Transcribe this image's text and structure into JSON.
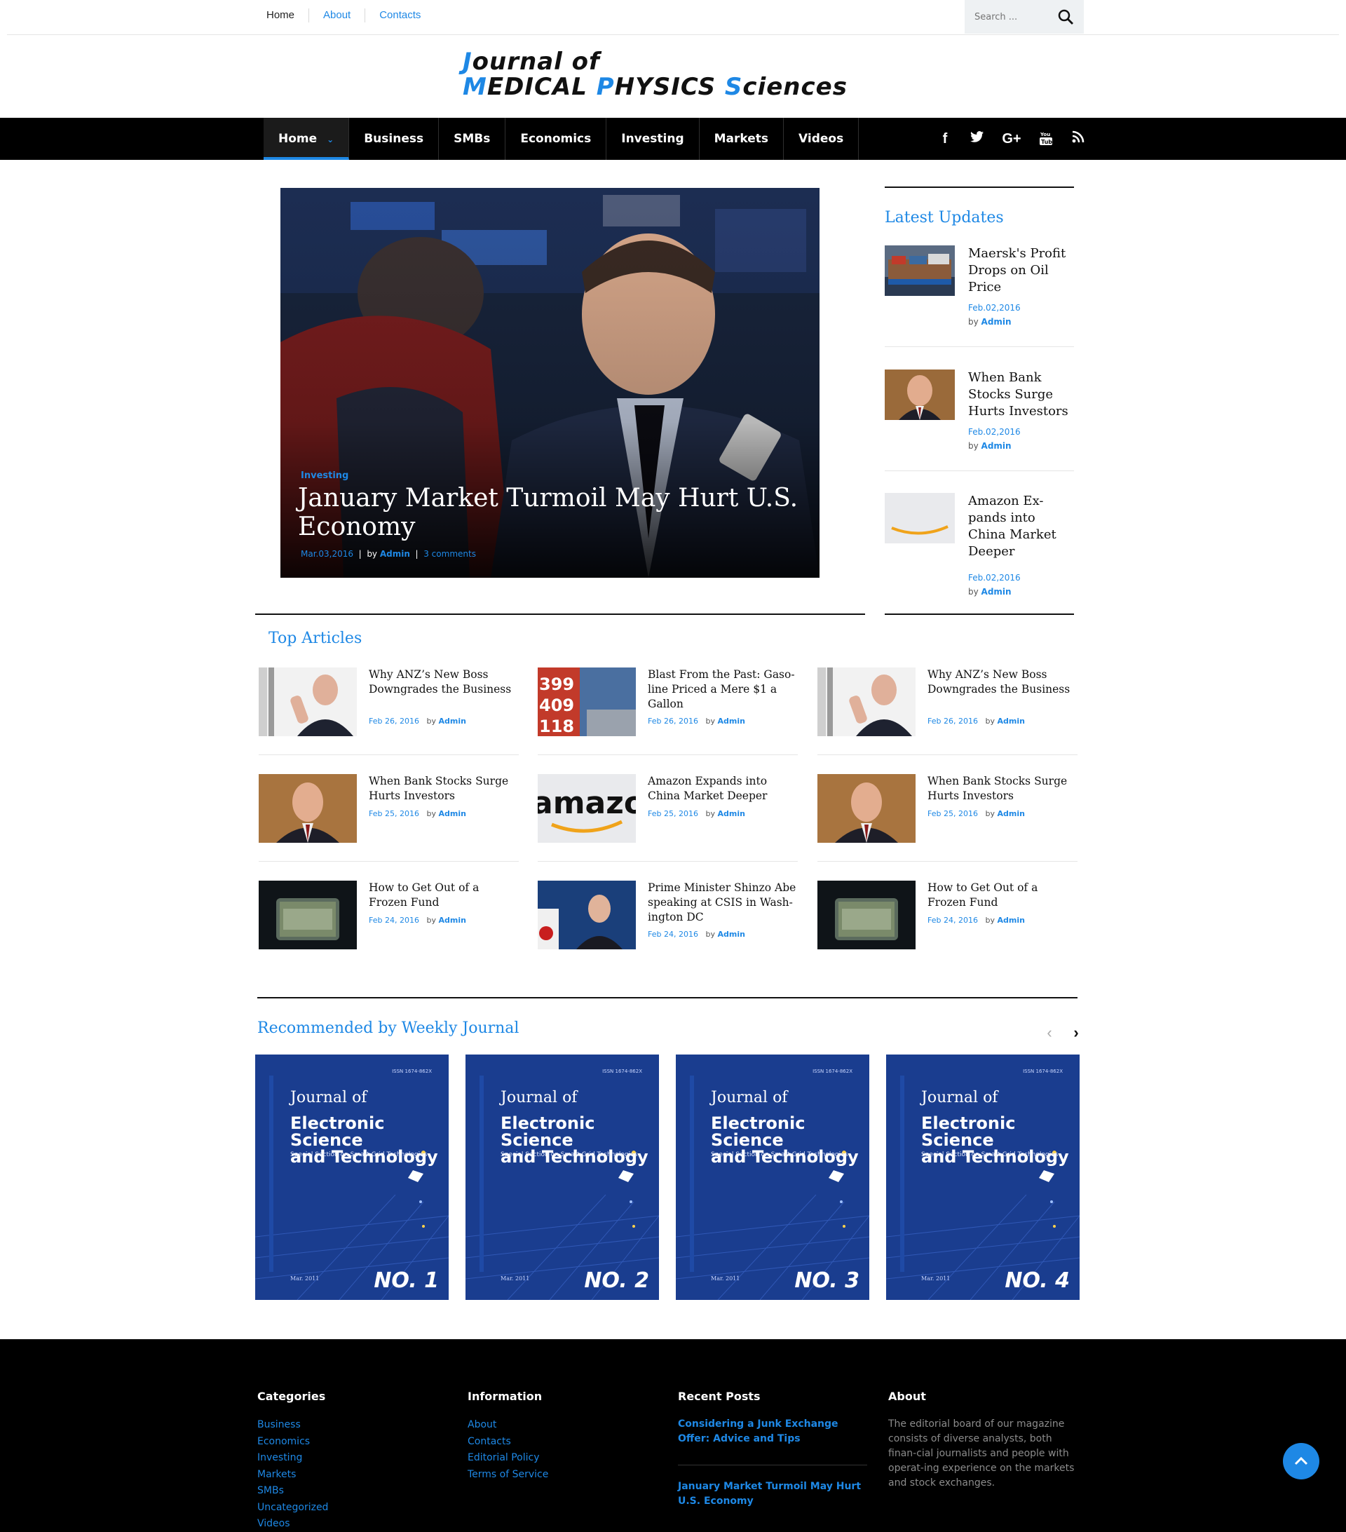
{
  "topbar": {
    "links": [
      "Home",
      "About",
      "Contacts"
    ],
    "search_placeholder": "Search ..."
  },
  "logo": {
    "line1_a": "J",
    "line1_b": "ournal of",
    "line2_a": "M",
    "line2_b": "EDICAL ",
    "line2_c": "P",
    "line2_d": "HYSICS ",
    "line2_e": "S",
    "line2_f": "ciences"
  },
  "nav": {
    "items": [
      "Home",
      "Business",
      "SMBs",
      "Economics",
      "Investing",
      "Markets",
      "Videos"
    ],
    "social": [
      "facebook-icon",
      "twitter-icon",
      "google-plus-icon",
      "youtube-icon",
      "rss-icon"
    ]
  },
  "hero": {
    "category": "Investing",
    "title": "January Market Turmoil May Hurt U.S. Economy",
    "date": "Mar.03,2016",
    "by": "by",
    "author": "Admin",
    "comments": "3 comments",
    "sep": "|"
  },
  "latest": {
    "heading": "Latest Updates",
    "items": [
      {
        "title": "Maersk's Profit Drops on Oil Price",
        "date": "Feb.02,2016",
        "by": "by",
        "author": "Admin"
      },
      {
        "title": "When Bank Stocks Surge Hurts Investors",
        "date": "Feb.02,2016",
        "by": "by",
        "author": "Admin"
      },
      {
        "title": "Amazon Ex-pands into China Market Deeper",
        "date": "Feb.02,2016",
        "by": "by",
        "author": "Admin"
      }
    ]
  },
  "top_articles": {
    "heading": "Top Articles",
    "items": [
      {
        "title": "Why ANZ’s New Boss Downgrades the Business",
        "date": "Feb 26, 2016",
        "by": "by",
        "author": "Admin"
      },
      {
        "title": "Blast From the Past: Gaso-line Priced a Mere $1 a Gallon",
        "date": "Feb 26, 2016",
        "by": "by",
        "author": "Admin"
      },
      {
        "title": "Why ANZ’s New Boss Downgrades the Business",
        "date": "Feb 26, 2016",
        "by": "by",
        "author": "Admin"
      },
      {
        "title": "When Bank Stocks Surge Hurts Investors",
        "date": "Feb 25, 2016",
        "by": "by",
        "author": "Admin"
      },
      {
        "title": "Amazon Expands into China Market Deeper",
        "date": "Feb 25, 2016",
        "by": "by",
        "author": "Admin"
      },
      {
        "title": "When Bank Stocks Surge Hurts Investors",
        "date": "Feb 25, 2016",
        "by": "by",
        "author": "Admin"
      },
      {
        "title": "How to Get Out of a Frozen Fund",
        "date": "Feb 24, 2016",
        "by": "by",
        "author": "Admin"
      },
      {
        "title": "Prime Minister Shinzo Abe speaking at CSIS in Wash-ington DC",
        "date": "Feb 24, 2016",
        "by": "by",
        "author": "Admin"
      },
      {
        "title": "How to Get Out of a Frozen Fund",
        "date": "Feb 24, 2016",
        "by": "by",
        "author": "Admin"
      }
    ]
  },
  "recommended": {
    "heading": "Recommended by Weekly Journal",
    "prev": "‹",
    "next": "›",
    "covers": [
      {
        "title1": "Journal of",
        "title2": "Electronic Science",
        "title3": "and Technology",
        "subtitle": "Special Section on Smart Grid Technologies",
        "issn": "ISSN 1674-862X",
        "date": "Mar. 2011",
        "number": "NO. 1"
      },
      {
        "title1": "Journal of",
        "title2": "Electronic Science",
        "title3": "and Technology",
        "subtitle": "Special Section on Smart Grid Technologies",
        "issn": "ISSN 1674-862X",
        "date": "Mar. 2011",
        "number": "NO. 2"
      },
      {
        "title1": "Journal of",
        "title2": "Electronic Science",
        "title3": "and Technology",
        "subtitle": "Special Section on Smart Grid Technologies",
        "issn": "ISSN 1674-862X",
        "date": "Mar. 2011",
        "number": "NO. 3"
      },
      {
        "title1": "Journal of",
        "title2": "Electronic Science",
        "title3": "and Technology",
        "subtitle": "Special Section on Smart Grid Technologies",
        "issn": "ISSN 1674-862X",
        "date": "Mar. 2011",
        "number": "NO. 4"
      }
    ]
  },
  "footer": {
    "categories": {
      "heading": "Categories",
      "links": [
        "Business",
        "Economics",
        "Investing",
        "Markets",
        "SMBs",
        "Uncategorized",
        "Videos"
      ]
    },
    "information": {
      "heading": "Information",
      "links": [
        "About",
        "Contacts",
        "Editorial Policy",
        "Terms of Service"
      ]
    },
    "recent": {
      "heading": "Recent Posts",
      "posts": [
        "Considering a Junk Exchange Offer: Advice and Tips",
        "January Market Turmoil May Hurt U.S. Economy"
      ]
    },
    "about": {
      "heading": "About",
      "text": "The editorial board of our magazine consists of diverse analysts, both finan-cial journalists and people with operat-ing experience on the markets and stock exchanges."
    }
  },
  "colors": {
    "accent": "#1e88e5",
    "nav_bg": "#000000",
    "footer_bg": "#000000",
    "cover_bg": "#1a3d8f"
  }
}
